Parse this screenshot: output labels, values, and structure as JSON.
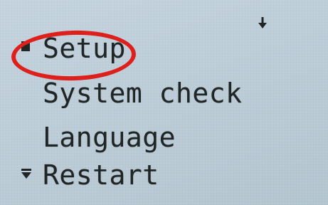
{
  "menu": {
    "items": [
      {
        "label": "Setup",
        "selected": true,
        "marker": "cursor-square"
      },
      {
        "label": "System check",
        "selected": false,
        "marker": ""
      },
      {
        "label": "Language",
        "selected": false,
        "marker": ""
      },
      {
        "label": "Restart",
        "selected": false,
        "marker": "scroll-down-marker"
      }
    ],
    "scroll_indicator": "down-arrow-icon"
  },
  "annotation": {
    "highlight_target": "Setup",
    "highlight_color": "#e0201c"
  },
  "colors": {
    "lcd_background": "#c3d2dc",
    "lcd_text": "#202626"
  }
}
